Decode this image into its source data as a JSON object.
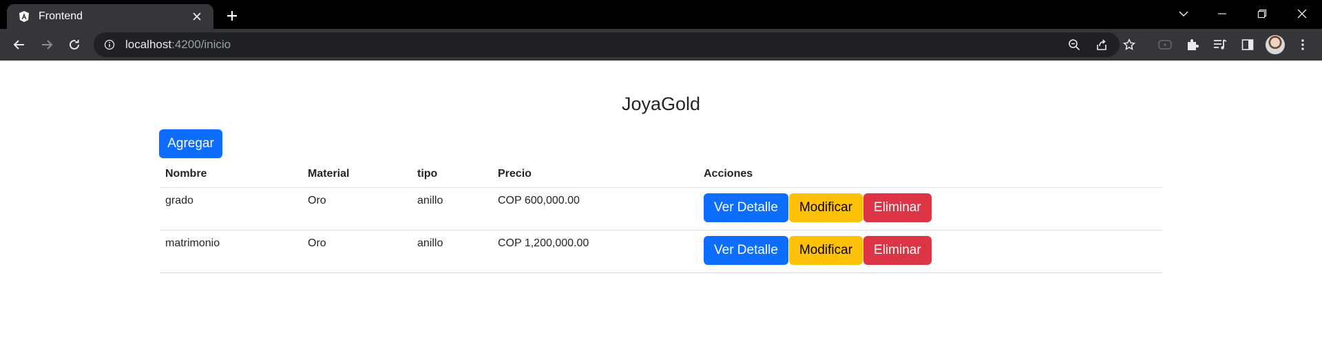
{
  "browser": {
    "tab_title": "Frontend",
    "url_host": "localhost",
    "url_path": ":4200/inicio",
    "accent_color": "#35363a"
  },
  "page": {
    "title": "JoyaGold",
    "add_button_label": "Agregar"
  },
  "table": {
    "headers": [
      "Nombre",
      "Material",
      "tipo",
      "Precio",
      "Acciones"
    ],
    "rows": [
      {
        "nombre": "grado",
        "material": "Oro",
        "tipo": "anillo",
        "precio": "COP 600,000.00"
      },
      {
        "nombre": "matrimonio",
        "material": "Oro",
        "tipo": "anillo",
        "precio": "COP 1,200,000.00"
      }
    ],
    "actions": {
      "view_label": "Ver Detalle",
      "edit_label": "Modificar",
      "delete_label": "Eliminar"
    }
  },
  "colors": {
    "primary": "#0d6efd",
    "warning": "#ffc107",
    "danger": "#dc3545"
  }
}
